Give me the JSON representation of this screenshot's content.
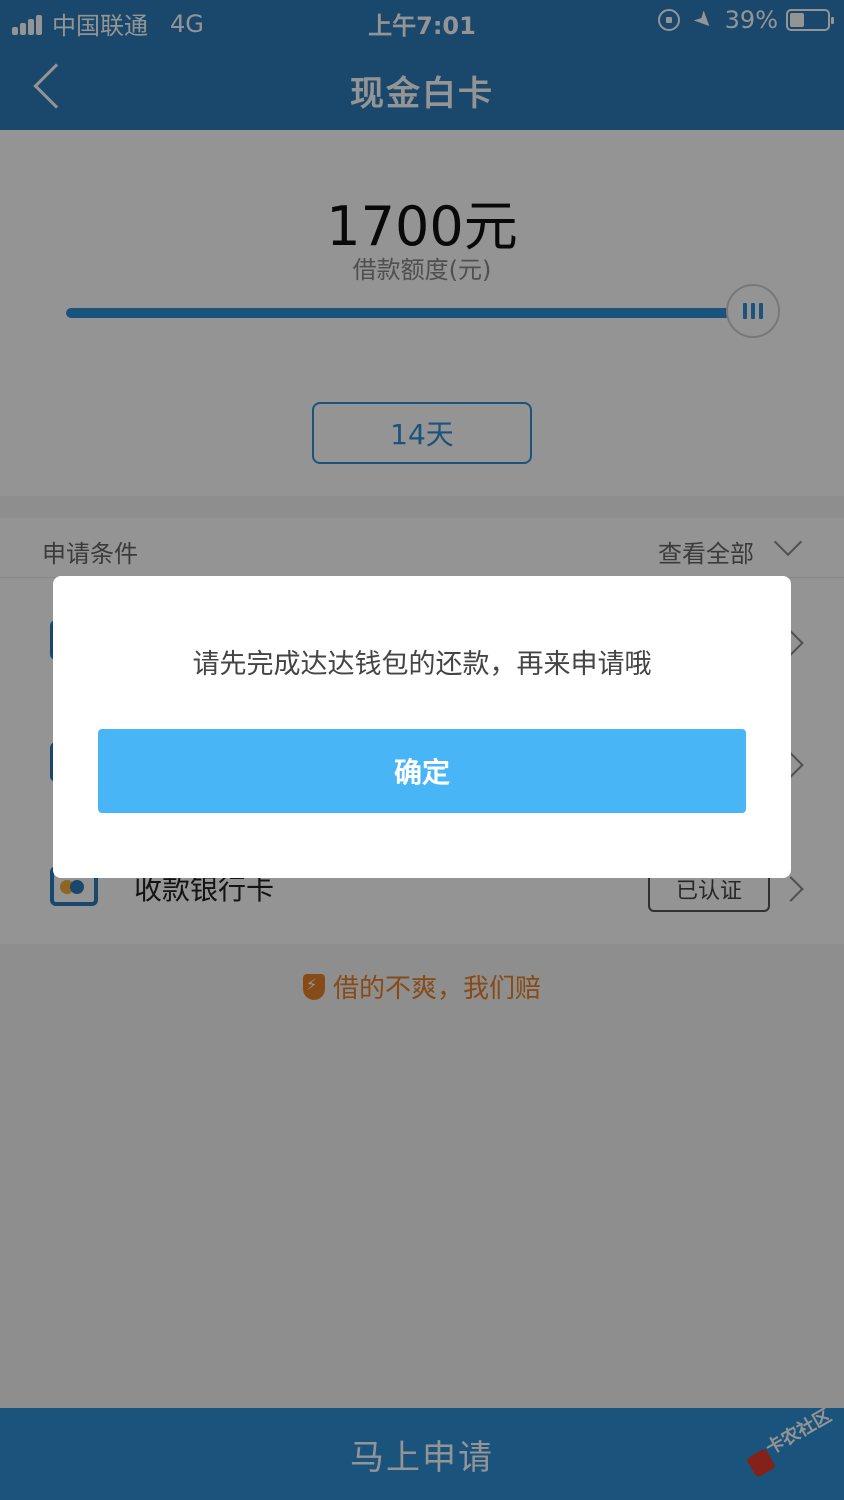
{
  "status_bar": {
    "carrier": "中国联通",
    "network": "4G",
    "time": "上午7:01",
    "battery": "39%"
  },
  "nav": {
    "title": "现金白卡"
  },
  "loan": {
    "amount": "1700元",
    "amount_label": "借款额度(元)",
    "slider_fraction": 1.0,
    "term": "14天"
  },
  "conditions": {
    "title": "申请条件",
    "view_all": "查看全部",
    "rows": [
      {
        "label": "",
        "status": ""
      },
      {
        "label": "",
        "status": ""
      },
      {
        "label": "收款银行卡",
        "status": "已认证"
      }
    ]
  },
  "guarantee": {
    "text": "借的不爽，我们赔"
  },
  "bottom": {
    "apply_label": "马上申请"
  },
  "watermark": {
    "text": "卡农社区"
  },
  "dialog": {
    "message": "请先完成达达钱包的还款，再来申请哦",
    "confirm_label": "确定"
  },
  "colors": {
    "nav_blue": "#2d7dba",
    "accent_blue": "#2d8fd6",
    "confirm_blue": "#48b5f7",
    "guarantee_orange": "#e8822a"
  }
}
